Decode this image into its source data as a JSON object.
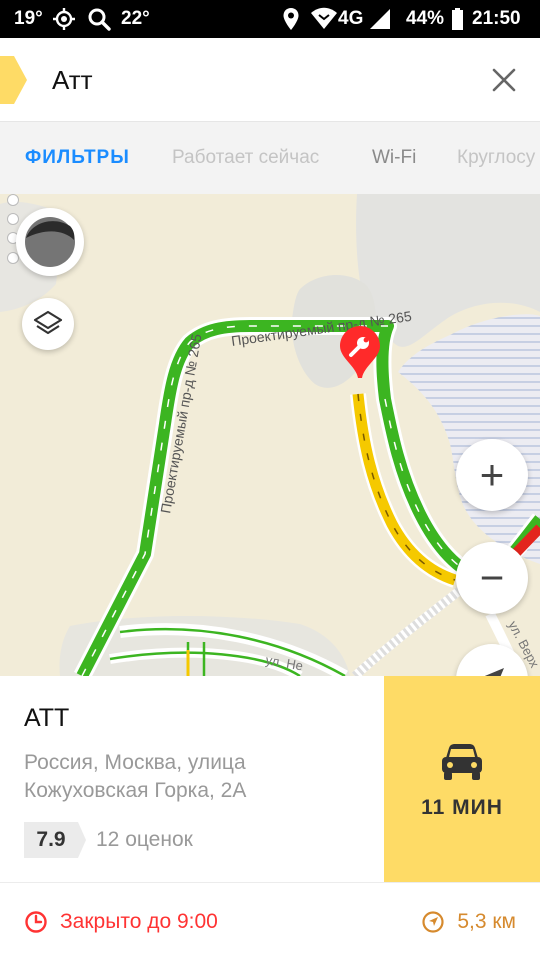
{
  "status_bar": {
    "weather_temp": "19°",
    "location_temp": "22°",
    "network": "4G",
    "battery": "44%",
    "time": "21:50"
  },
  "search": {
    "query": "Атт"
  },
  "filters": [
    {
      "label": "ФИЛЬТРЫ"
    },
    {
      "label": "Работает сейчас"
    },
    {
      "label": "Wi-Fi"
    },
    {
      "label": "Круглосу"
    }
  ],
  "map": {
    "street_labels": [
      "Проектируемый пр-д № 265",
      "Проектируемый пр-д № 265",
      "ул. Не",
      "ул. Верх"
    ],
    "zoom_in_label": "+",
    "zoom_out_label": "−"
  },
  "place": {
    "name": "АТТ",
    "address_line1": "Россия, Москва, улица",
    "address_line2": "Кожуховская Горка, 2А",
    "rating": "7.9",
    "rating_count": "12 оценок",
    "route_time": "11 МИН",
    "hours": "Закрыто до 9:00",
    "distance": "5,3 км"
  },
  "colors": {
    "accent_yellow": "#fedb66",
    "filter_blue": "#1a8cff",
    "closed_red": "#ff3333",
    "distance_orange": "#d68a2e",
    "traffic_green": "#3cb521",
    "traffic_yellow": "#f5c900",
    "pin_red": "#ff2a2a"
  }
}
